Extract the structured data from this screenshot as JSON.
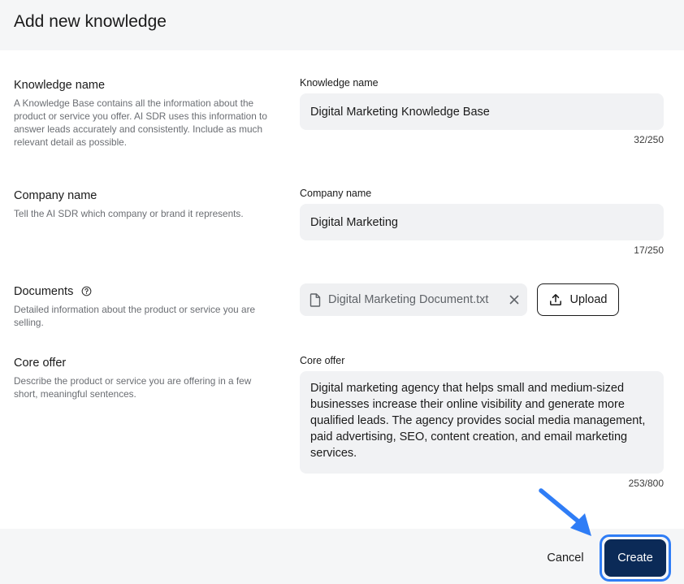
{
  "header": {
    "title": "Add new knowledge"
  },
  "sections": {
    "knowledge_name": {
      "title": "Knowledge name",
      "description": "A Knowledge Base contains all the information about the product or service you offer. AI SDR uses this information to answer leads accurately and consistently. Include as much relevant detail as possible.",
      "field_label": "Knowledge name",
      "value": "Digital Marketing Knowledge Base",
      "counter": "32/250"
    },
    "company_name": {
      "title": "Company name",
      "description": "Tell the AI SDR which company or brand it represents.",
      "field_label": "Company name",
      "value": "Digital Marketing",
      "counter": "17/250"
    },
    "documents": {
      "title": "Documents",
      "description": "Detailed information about the product or service you are selling.",
      "file_name": "Digital Marketing Document.txt",
      "upload_label": "Upload"
    },
    "core_offer": {
      "title": "Core offer",
      "description": "Describe the product or service you are offering in a few short, meaningful sentences.",
      "field_label": "Core offer",
      "value": "Digital marketing agency that helps small and medium-sized businesses increase their online visibility and generate more qualified leads. The agency provides social media management, paid advertising, SEO, content creation, and email marketing services.",
      "counter": "253/800"
    }
  },
  "footer": {
    "cancel_label": "Cancel",
    "create_label": "Create"
  },
  "colors": {
    "primary": "#0b2a57",
    "focus_ring": "#2f7df6",
    "arrow": "#2f7df6"
  }
}
